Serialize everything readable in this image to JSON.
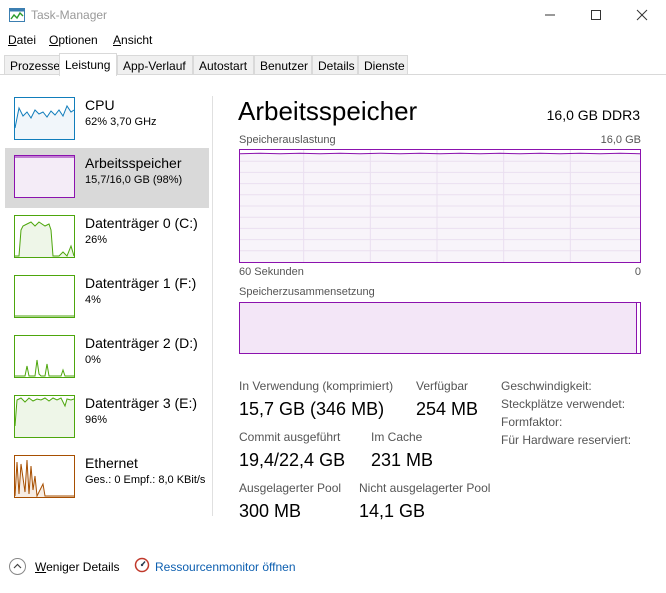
{
  "window": {
    "title": "Task-Manager"
  },
  "menu": [
    {
      "label": "Datei",
      "mnemonic": "D",
      "rest": "atei"
    },
    {
      "label": "Optionen",
      "mnemonic": "O",
      "rest": "ptionen"
    },
    {
      "label": "Ansicht",
      "mnemonic": "A",
      "rest": "nsicht"
    }
  ],
  "tabs": [
    "Prozesse",
    "Leistung",
    "App-Verlauf",
    "Autostart",
    "Benutzer",
    "Details",
    "Dienste"
  ],
  "active_tab": "Leistung",
  "sidebar": {
    "items": [
      {
        "name": "CPU",
        "value": "62% 3,70 GHz",
        "color": "#117dbb",
        "level_percent": 62,
        "selected": false
      },
      {
        "name": "Arbeitsspeicher",
        "value": "15,7/16,0 GB (98%)",
        "color": "#8b12ae",
        "level_percent": 98,
        "selected": true
      },
      {
        "name": "Datenträger 0 (C:)",
        "value": "26%",
        "color": "#4da60c",
        "level_percent": 26,
        "selected": false
      },
      {
        "name": "Datenträger 1 (F:)",
        "value": "4%",
        "color": "#4da60c",
        "level_percent": 4,
        "selected": false
      },
      {
        "name": "Datenträger 2 (D:)",
        "value": "0%",
        "color": "#4da60c",
        "level_percent": 0,
        "selected": false
      },
      {
        "name": "Datenträger 3 (E:)",
        "value": "96%",
        "color": "#4da60c",
        "level_percent": 96,
        "selected": false
      },
      {
        "name": "Ethernet",
        "value": "Ges.: 0 Empf.: 8,0 KBit/s",
        "color": "#a74f01",
        "level_percent": 50,
        "selected": false
      }
    ]
  },
  "main": {
    "title": "Arbeitsspeicher",
    "spec": "16,0 GB DDR3",
    "usage_label": "Speicherauslastung",
    "usage_max": "16,0 GB",
    "time_left": "60 Sekunden",
    "time_right": "0",
    "composition_label": "Speicherzusammensetzung",
    "usage_level_percent": 98,
    "stats": {
      "in_use_label": "In Verwendung (komprimiert)",
      "in_use_value": "15,7 GB (346 MB)",
      "available_label": "Verfügbar",
      "available_value": "254 MB",
      "commit_label": "Commit ausgeführt",
      "commit_value": "19,4/22,4 GB",
      "cache_label": "Im Cache",
      "cache_value": "231 MB",
      "paged_label": "Ausgelagerter Pool",
      "paged_value": "300 MB",
      "nonpaged_label": "Nicht ausgelagerter Pool",
      "nonpaged_value": "14,1 GB"
    },
    "details": {
      "speed": "Geschwindigkeit:",
      "slots": "Steckplätze verwendet:",
      "form": "Formfaktor:",
      "reserved": "Für Hardware reserviert:"
    }
  },
  "footer": {
    "fewer_details": "Weniger Details",
    "fewer_details_mnemonic": "W",
    "fewer_details_rest": "eniger Details",
    "resource_monitor": "Ressourcenmonitor öffnen"
  },
  "colors": {
    "memory": "#8b12ae",
    "cpu": "#117dbb",
    "disk": "#4da60c",
    "ethernet": "#a74f01",
    "link": "#0d5fb0"
  }
}
